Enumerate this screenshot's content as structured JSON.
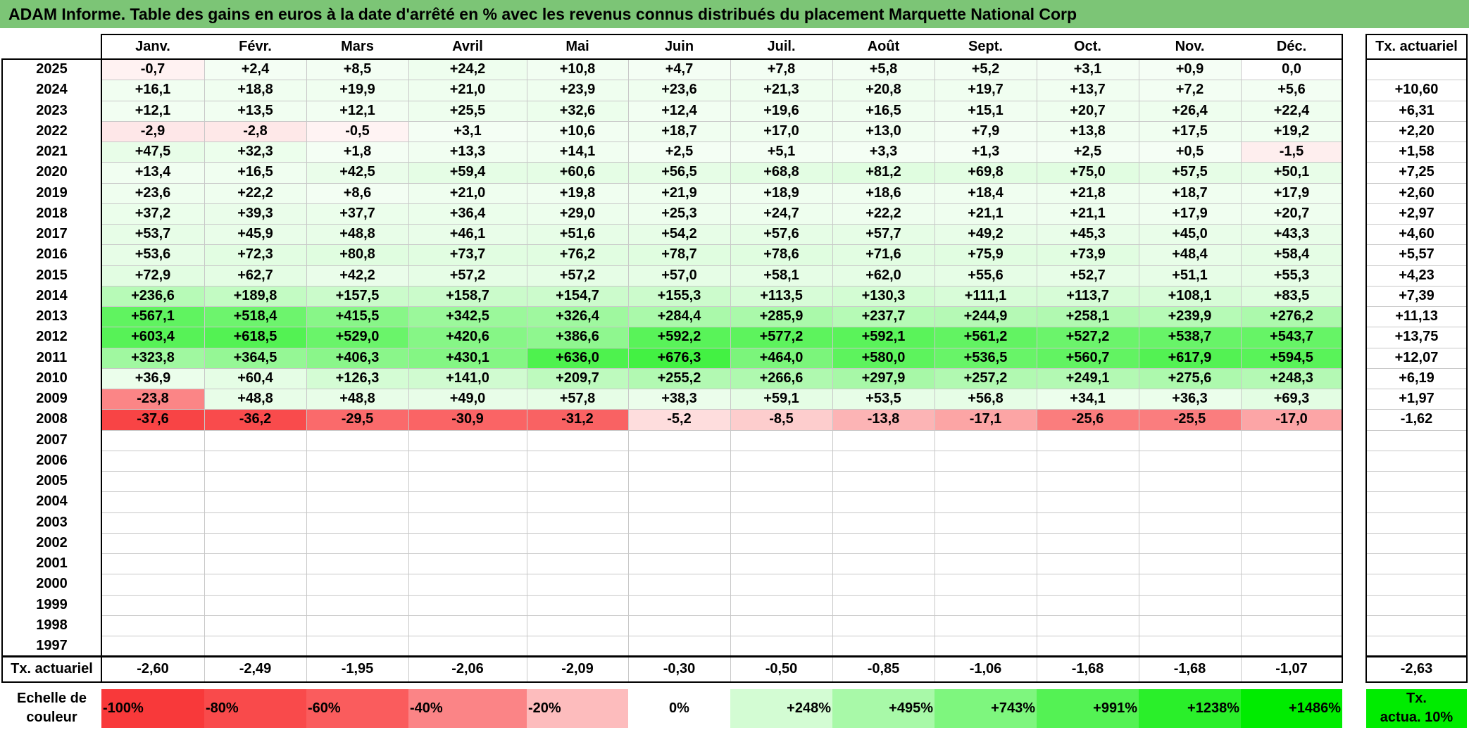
{
  "title": "ADAM Informe. Table des gains en euros à la date d'arrêté en % avec les revenus connus distribués du placement Marquette National Corp",
  "months": [
    "Janv.",
    "Févr.",
    "Mars",
    "Avril",
    "Mai",
    "Juin",
    "Juil.",
    "Août",
    "Sept.",
    "Oct.",
    "Nov.",
    "Déc."
  ],
  "tx_header": "Tx. actuariel",
  "rows": [
    {
      "year": "2025",
      "values": [
        "-0,7",
        "+2,4",
        "+8,5",
        "+24,2",
        "+10,8",
        "+4,7",
        "+7,8",
        "+5,8",
        "+5,2",
        "+3,1",
        "+0,9",
        "0,0"
      ],
      "tx": ""
    },
    {
      "year": "2024",
      "values": [
        "+16,1",
        "+18,8",
        "+19,9",
        "+21,0",
        "+23,9",
        "+23,6",
        "+21,3",
        "+20,8",
        "+19,7",
        "+13,7",
        "+7,2",
        "+5,6"
      ],
      "tx": "+10,60"
    },
    {
      "year": "2023",
      "values": [
        "+12,1",
        "+13,5",
        "+12,1",
        "+25,5",
        "+32,6",
        "+12,4",
        "+19,6",
        "+16,5",
        "+15,1",
        "+20,7",
        "+26,4",
        "+22,4"
      ],
      "tx": "+6,31"
    },
    {
      "year": "2022",
      "values": [
        "-2,9",
        "-2,8",
        "-0,5",
        "+3,1",
        "+10,6",
        "+18,7",
        "+17,0",
        "+13,0",
        "+7,9",
        "+13,8",
        "+17,5",
        "+19,2"
      ],
      "tx": "+2,20"
    },
    {
      "year": "2021",
      "values": [
        "+47,5",
        "+32,3",
        "+1,8",
        "+13,3",
        "+14,1",
        "+2,5",
        "+5,1",
        "+3,3",
        "+1,3",
        "+2,5",
        "+0,5",
        "-1,5"
      ],
      "tx": "+1,58"
    },
    {
      "year": "2020",
      "values": [
        "+13,4",
        "+16,5",
        "+42,5",
        "+59,4",
        "+60,6",
        "+56,5",
        "+68,8",
        "+81,2",
        "+69,8",
        "+75,0",
        "+57,5",
        "+50,1"
      ],
      "tx": "+7,25"
    },
    {
      "year": "2019",
      "values": [
        "+23,6",
        "+22,2",
        "+8,6",
        "+21,0",
        "+19,8",
        "+21,9",
        "+18,9",
        "+18,6",
        "+18,4",
        "+21,8",
        "+18,7",
        "+17,9"
      ],
      "tx": "+2,60"
    },
    {
      "year": "2018",
      "values": [
        "+37,2",
        "+39,3",
        "+37,7",
        "+36,4",
        "+29,0",
        "+25,3",
        "+24,7",
        "+22,2",
        "+21,1",
        "+21,1",
        "+17,9",
        "+20,7"
      ],
      "tx": "+2,97"
    },
    {
      "year": "2017",
      "values": [
        "+53,7",
        "+45,9",
        "+48,8",
        "+46,1",
        "+51,6",
        "+54,2",
        "+57,6",
        "+57,7",
        "+49,2",
        "+45,3",
        "+45,0",
        "+43,3"
      ],
      "tx": "+4,60"
    },
    {
      "year": "2016",
      "values": [
        "+53,6",
        "+72,3",
        "+80,8",
        "+73,7",
        "+76,2",
        "+78,7",
        "+78,6",
        "+71,6",
        "+75,9",
        "+73,9",
        "+48,4",
        "+58,4"
      ],
      "tx": "+5,57"
    },
    {
      "year": "2015",
      "values": [
        "+72,9",
        "+62,7",
        "+42,2",
        "+57,2",
        "+57,2",
        "+57,0",
        "+58,1",
        "+62,0",
        "+55,6",
        "+52,7",
        "+51,1",
        "+55,3"
      ],
      "tx": "+4,23"
    },
    {
      "year": "2014",
      "values": [
        "+236,6",
        "+189,8",
        "+157,5",
        "+158,7",
        "+154,7",
        "+155,3",
        "+113,5",
        "+130,3",
        "+111,1",
        "+113,7",
        "+108,1",
        "+83,5"
      ],
      "tx": "+7,39"
    },
    {
      "year": "2013",
      "values": [
        "+567,1",
        "+518,4",
        "+415,5",
        "+342,5",
        "+326,4",
        "+284,4",
        "+285,9",
        "+237,7",
        "+244,9",
        "+258,1",
        "+239,9",
        "+276,2"
      ],
      "tx": "+11,13"
    },
    {
      "year": "2012",
      "values": [
        "+603,4",
        "+618,5",
        "+529,0",
        "+420,6",
        "+386,6",
        "+592,2",
        "+577,2",
        "+592,1",
        "+561,2",
        "+527,2",
        "+538,7",
        "+543,7"
      ],
      "tx": "+13,75"
    },
    {
      "year": "2011",
      "values": [
        "+323,8",
        "+364,5",
        "+406,3",
        "+430,1",
        "+636,0",
        "+676,3",
        "+464,0",
        "+580,0",
        "+536,5",
        "+560,7",
        "+617,9",
        "+594,5"
      ],
      "tx": "+12,07"
    },
    {
      "year": "2010",
      "values": [
        "+36,9",
        "+60,4",
        "+126,3",
        "+141,0",
        "+209,7",
        "+255,2",
        "+266,6",
        "+297,9",
        "+257,2",
        "+249,1",
        "+275,6",
        "+248,3"
      ],
      "tx": "+6,19"
    },
    {
      "year": "2009",
      "values": [
        "-23,8",
        "+48,8",
        "+48,8",
        "+49,0",
        "+57,8",
        "+38,3",
        "+59,1",
        "+53,5",
        "+56,8",
        "+34,1",
        "+36,3",
        "+69,3"
      ],
      "tx": "+1,97"
    },
    {
      "year": "2008",
      "values": [
        "-37,6",
        "-36,2",
        "-29,5",
        "-30,9",
        "-31,2",
        "-5,2",
        "-8,5",
        "-13,8",
        "-17,1",
        "-25,6",
        "-25,5",
        "-17,0"
      ],
      "tx": "-1,62"
    },
    {
      "year": "2007",
      "values": [
        "",
        "",
        "",
        "",
        "",
        "",
        "",
        "",
        "",
        "",
        "",
        ""
      ],
      "tx": ""
    },
    {
      "year": "2006",
      "values": [
        "",
        "",
        "",
        "",
        "",
        "",
        "",
        "",
        "",
        "",
        "",
        ""
      ],
      "tx": ""
    },
    {
      "year": "2005",
      "values": [
        "",
        "",
        "",
        "",
        "",
        "",
        "",
        "",
        "",
        "",
        "",
        ""
      ],
      "tx": ""
    },
    {
      "year": "2004",
      "values": [
        "",
        "",
        "",
        "",
        "",
        "",
        "",
        "",
        "",
        "",
        "",
        ""
      ],
      "tx": ""
    },
    {
      "year": "2003",
      "values": [
        "",
        "",
        "",
        "",
        "",
        "",
        "",
        "",
        "",
        "",
        "",
        ""
      ],
      "tx": ""
    },
    {
      "year": "2002",
      "values": [
        "",
        "",
        "",
        "",
        "",
        "",
        "",
        "",
        "",
        "",
        "",
        ""
      ],
      "tx": ""
    },
    {
      "year": "2001",
      "values": [
        "",
        "",
        "",
        "",
        "",
        "",
        "",
        "",
        "",
        "",
        "",
        ""
      ],
      "tx": ""
    },
    {
      "year": "2000",
      "values": [
        "",
        "",
        "",
        "",
        "",
        "",
        "",
        "",
        "",
        "",
        "",
        ""
      ],
      "tx": ""
    },
    {
      "year": "1999",
      "values": [
        "",
        "",
        "",
        "",
        "",
        "",
        "",
        "",
        "",
        "",
        "",
        ""
      ],
      "tx": ""
    },
    {
      "year": "1998",
      "values": [
        "",
        "",
        "",
        "",
        "",
        "",
        "",
        "",
        "",
        "",
        "",
        ""
      ],
      "tx": ""
    },
    {
      "year": "1997",
      "values": [
        "",
        "",
        "",
        "",
        "",
        "",
        "",
        "",
        "",
        "",
        "",
        ""
      ],
      "tx": ""
    }
  ],
  "summary": {
    "label": "Tx. actuariel",
    "values": [
      "-2,60",
      "-2,49",
      "-1,95",
      "-2,06",
      "-2,09",
      "-0,30",
      "-0,50",
      "-0,85",
      "-1,06",
      "-1,68",
      "-1,68",
      "-1,07"
    ],
    "tx": "-2,63"
  },
  "scale": {
    "label_line1": "Echelle de",
    "label_line2": "couleur",
    "steps": [
      {
        "text": "-100%",
        "color": "#f8393a"
      },
      {
        "text": "-80%",
        "color": "#f94a4b"
      },
      {
        "text": "-60%",
        "color": "#fa5c5d"
      },
      {
        "text": "-40%",
        "color": "#fb8486"
      },
      {
        "text": "-20%",
        "color": "#fdbcbd"
      },
      {
        "text": "0%",
        "color": "#ffffff"
      },
      {
        "text": "+248%",
        "color": "#d3fcd3"
      },
      {
        "text": "+495%",
        "color": "#a8f9a8"
      },
      {
        "text": "+743%",
        "color": "#7ef67e"
      },
      {
        "text": "+991%",
        "color": "#54f254"
      },
      {
        "text": "+1238%",
        "color": "#2aef2a"
      },
      {
        "text": "+1486%",
        "color": "#00ec00"
      }
    ],
    "tx_line1": "Tx.",
    "tx_line2": "actua. 10%",
    "tx_color": "#00ec00"
  },
  "colors": {
    "title_bg": "#7cc576",
    "positive_max": "#00ec00",
    "negative_max": "#f8393a"
  }
}
